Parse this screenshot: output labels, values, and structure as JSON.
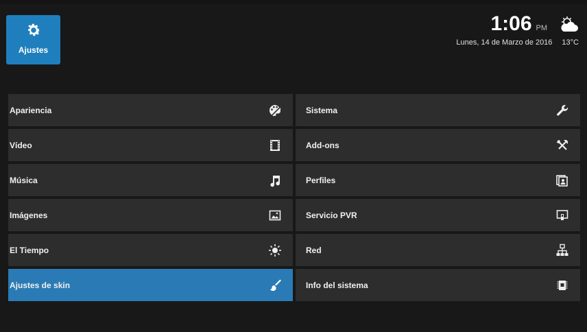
{
  "header": {
    "home_label": "Ajustes",
    "time": "1:06",
    "ampm": "PM",
    "date": "Lunes, 14 de Marzo de 2016",
    "temperature": "13°C",
    "weather_icon": "cloudy-icon"
  },
  "menu": {
    "left": [
      {
        "label": "Apariencia",
        "icon": "palette-icon"
      },
      {
        "label": "Vídeo",
        "icon": "film-icon"
      },
      {
        "label": "Música",
        "icon": "music-note-icon"
      },
      {
        "label": "Imágenes",
        "icon": "picture-icon"
      },
      {
        "label": "El Tiempo",
        "icon": "sun-icon"
      },
      {
        "label": "Ajustes de skin",
        "icon": "brush-icon",
        "selected": true
      }
    ],
    "right": [
      {
        "label": "Sistema",
        "icon": "wrench-icon"
      },
      {
        "label": "Add-ons",
        "icon": "tools-icon"
      },
      {
        "label": "Perfiles",
        "icon": "profiles-icon"
      },
      {
        "label": "Servicio PVR",
        "icon": "pvr-icon"
      },
      {
        "label": "Red",
        "icon": "network-icon"
      },
      {
        "label": "Info del sistema",
        "icon": "chip-icon"
      }
    ]
  },
  "colors": {
    "accent": "#2a7bb5",
    "tile": "#2d2d2d",
    "background": "#181818"
  }
}
